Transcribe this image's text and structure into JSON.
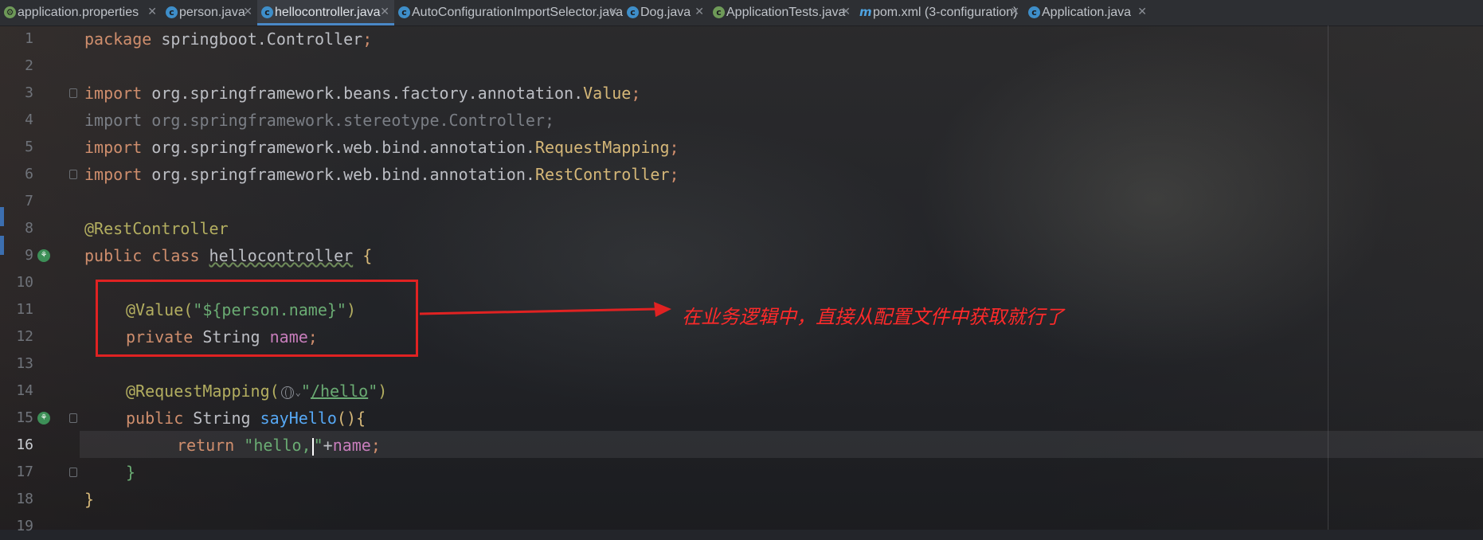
{
  "tabs": [
    {
      "label": "application.properties",
      "icon": "properties-file-icon",
      "active": false
    },
    {
      "label": "person.java",
      "icon": "java-class-icon",
      "active": false
    },
    {
      "label": "hellocontroller.java",
      "icon": "java-class-icon",
      "active": true
    },
    {
      "label": "AutoConfigurationImportSelector.java",
      "icon": "java-class-icon",
      "active": false
    },
    {
      "label": "Dog.java",
      "icon": "java-class-icon",
      "active": false
    },
    {
      "label": "ApplicationTests.java",
      "icon": "java-test-class-icon",
      "active": false
    },
    {
      "label": "pom.xml (3-configuration)",
      "icon": "maven-icon",
      "active": false
    },
    {
      "label": "Application.java",
      "icon": "java-class-icon",
      "active": false
    }
  ],
  "editor": {
    "current_line": "16",
    "line_numbers": [
      "1",
      "2",
      "3",
      "4",
      "5",
      "6",
      "7",
      "8",
      "9",
      "10",
      "11",
      "12",
      "13",
      "14",
      "15",
      "16",
      "17",
      "18",
      "19"
    ],
    "code": {
      "l1": {
        "kw": "package",
        "rest": " springboot.Controller",
        "semi": ";"
      },
      "l3": {
        "kw": "import",
        "pkg": " org.springframework.beans.factory.annotation.",
        "cls": "Value",
        "semi": ";"
      },
      "l4": {
        "text": "import org.springframework.stereotype.Controller;"
      },
      "l5": {
        "kw": "import",
        "pkg": " org.springframework.web.bind.annotation.",
        "cls": "RequestMapping",
        "semi": ";"
      },
      "l6": {
        "kw": "import",
        "pkg": " org.springframework.web.bind.annotation.",
        "cls": "RestController",
        "semi": ";"
      },
      "l8": {
        "ann": "@RestController"
      },
      "l9": {
        "kw": "public class ",
        "name": "hellocontroller",
        "brace": " {"
      },
      "l11": {
        "ann": "@Value(",
        "str": "\"${person.name}\"",
        "close": ")"
      },
      "l12": {
        "kw": "private ",
        "type": "String ",
        "field": "name",
        "semi": ";"
      },
      "l14": {
        "ann": "@RequestMapping(",
        "str_q": "\"",
        "str_path": "/hello",
        "str_q2": "\"",
        "close": ")"
      },
      "l15": {
        "kw": "public ",
        "type": "String ",
        "fn": "sayHello",
        "paren": "()",
        "brace": "{"
      },
      "l16": {
        "kw": "return ",
        "str": "\"hello,",
        "str2": "\"",
        "op": "+",
        "field": "name",
        "semi": ";"
      },
      "l17": {
        "brace": "}"
      },
      "l18": {
        "brace": "}"
      }
    }
  },
  "annotation_note": "在业务逻辑中，直接从配置文件中获取就行了",
  "colors": {
    "highlight_box": "#e02222",
    "note": "#ff2a2a"
  }
}
